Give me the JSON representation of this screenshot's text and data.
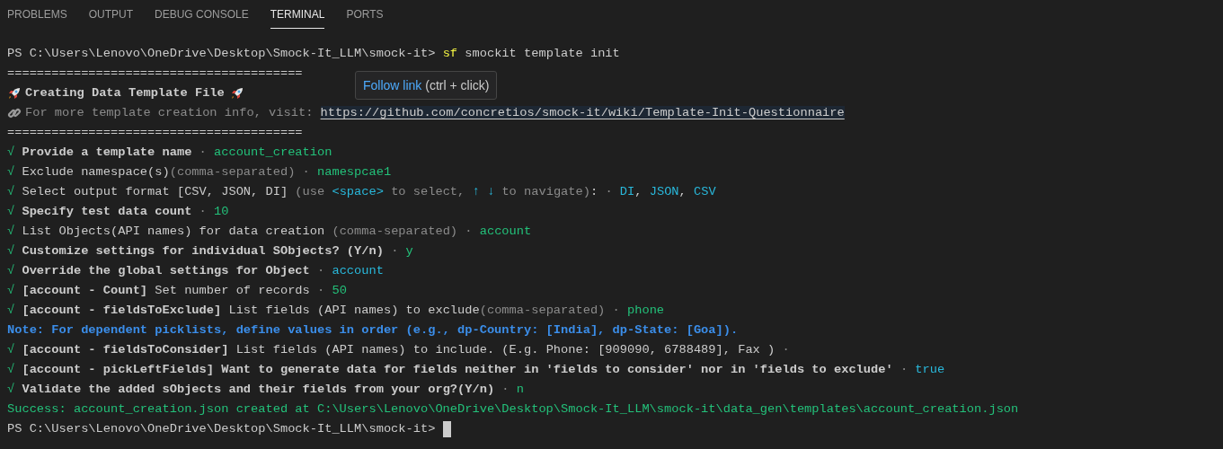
{
  "tabs": [
    {
      "label": "PROBLEMS",
      "selected": false
    },
    {
      "label": "OUTPUT",
      "selected": false
    },
    {
      "label": "DEBUG CONSOLE",
      "selected": false
    },
    {
      "label": "TERMINAL",
      "selected": true
    },
    {
      "label": "PORTS",
      "selected": false
    }
  ],
  "terminal": {
    "lines": [
      {
        "kind": "plain",
        "segments": [
          {
            "kind": "plain",
            "text": "PS C:\\Users\\Lenovo\\OneDrive\\Desktop\\Smock-It_LLM\\smock-it> "
          },
          {
            "kind": "yellow",
            "text": "sf"
          },
          {
            "kind": "plain",
            "text": " smockit template init"
          }
        ]
      },
      {
        "kind": "plain",
        "segments": [
          {
            "kind": "plain",
            "text": "========================================"
          }
        ]
      },
      {
        "kind": "banner",
        "segments": [
          {
            "kind": "bold",
            "text": "Creating Data Template File"
          }
        ]
      },
      {
        "kind": "info",
        "segments": [
          {
            "kind": "dim",
            "text": "For more template creation info, visit: "
          },
          {
            "kind": "link",
            "text": "https://github.com/concretios/smock-it/wiki/Template-Init-Questionnaire"
          }
        ]
      },
      {
        "kind": "plain",
        "segments": [
          {
            "kind": "plain",
            "text": "========================================"
          }
        ]
      },
      {
        "kind": "plain",
        "segments": [
          {
            "kind": "green",
            "text": "√ "
          },
          {
            "kind": "bold",
            "text": "Provide a template name"
          },
          {
            "kind": "dim",
            "text": " · "
          },
          {
            "kind": "green",
            "text": "account_creation"
          }
        ]
      },
      {
        "kind": "plain",
        "segments": [
          {
            "kind": "green",
            "text": "√ "
          },
          {
            "kind": "plain",
            "text": "Exclude namespace(s)"
          },
          {
            "kind": "dim",
            "text": "(comma-separated) · "
          },
          {
            "kind": "green",
            "text": "namespcae1"
          }
        ]
      },
      {
        "kind": "plain",
        "segments": [
          {
            "kind": "green",
            "text": "√ "
          },
          {
            "kind": "plain",
            "text": "Select output format [CSV, JSON, DI] "
          },
          {
            "kind": "dim",
            "text": "(use "
          },
          {
            "kind": "cyan",
            "text": "<space>"
          },
          {
            "kind": "dim",
            "text": " to select, "
          },
          {
            "kind": "cyan",
            "text": "↑ ↓"
          },
          {
            "kind": "dim",
            "text": " to navigate)"
          },
          {
            "kind": "plain",
            "text": ": "
          },
          {
            "kind": "dim",
            "text": "· "
          },
          {
            "kind": "cyan",
            "text": "DI"
          },
          {
            "kind": "plain",
            "text": ", "
          },
          {
            "kind": "cyan",
            "text": "JSON"
          },
          {
            "kind": "plain",
            "text": ", "
          },
          {
            "kind": "cyan",
            "text": "CSV"
          }
        ]
      },
      {
        "kind": "plain",
        "segments": [
          {
            "kind": "green",
            "text": "√ "
          },
          {
            "kind": "bold",
            "text": "Specify test data count"
          },
          {
            "kind": "dim",
            "text": " · "
          },
          {
            "kind": "green",
            "text": "10"
          }
        ]
      },
      {
        "kind": "plain",
        "segments": [
          {
            "kind": "green",
            "text": "√ "
          },
          {
            "kind": "plain",
            "text": "List Objects(API names) for data creation "
          },
          {
            "kind": "dim",
            "text": "(comma-separated) · "
          },
          {
            "kind": "green",
            "text": "account"
          }
        ]
      },
      {
        "kind": "plain",
        "segments": [
          {
            "kind": "green",
            "text": "√ "
          },
          {
            "kind": "bold",
            "text": "Customize settings for individual SObjects? (Y/n)"
          },
          {
            "kind": "dim",
            "text": " · "
          },
          {
            "kind": "green",
            "text": "y"
          }
        ]
      },
      {
        "kind": "plain",
        "segments": [
          {
            "kind": "green",
            "text": "√ "
          },
          {
            "kind": "bold",
            "text": "Override the global settings for Object"
          },
          {
            "kind": "dim",
            "text": " · "
          },
          {
            "kind": "cyan",
            "text": "account"
          }
        ]
      },
      {
        "kind": "plain",
        "segments": [
          {
            "kind": "green",
            "text": "√ "
          },
          {
            "kind": "bold",
            "text": "[account - Count]"
          },
          {
            "kind": "plain",
            "text": " Set number of records"
          },
          {
            "kind": "dim",
            "text": " · "
          },
          {
            "kind": "green",
            "text": "50"
          }
        ]
      },
      {
        "kind": "plain",
        "segments": [
          {
            "kind": "green",
            "text": "√ "
          },
          {
            "kind": "bold",
            "text": "[account - fieldsToExclude]"
          },
          {
            "kind": "plain",
            "text": " List fields (API names) to exclude"
          },
          {
            "kind": "dim",
            "text": "(comma-separated) · "
          },
          {
            "kind": "green",
            "text": "phone"
          }
        ]
      },
      {
        "kind": "plain",
        "segments": [
          {
            "kind": "note",
            "text": "Note: For dependent picklists, define values in order (e.g., dp-Country: [India], dp-State: [Goa])."
          }
        ]
      },
      {
        "kind": "plain",
        "segments": [
          {
            "kind": "green",
            "text": "√ "
          },
          {
            "kind": "bold",
            "text": "[account - fieldsToConsider]"
          },
          {
            "kind": "plain",
            "text": " List fields (API names) to include. (E.g. Phone: [909090, 6788489], Fax ) "
          },
          {
            "kind": "dim",
            "text": "·"
          }
        ]
      },
      {
        "kind": "plain",
        "segments": [
          {
            "kind": "green",
            "text": "√ "
          },
          {
            "kind": "bold",
            "text": "[account - pickLeftFields] Want to generate data for fields neither in 'fields to consider' nor in 'fields to exclude'"
          },
          {
            "kind": "dim",
            "text": " · "
          },
          {
            "kind": "cyan",
            "text": "true"
          }
        ]
      },
      {
        "kind": "plain",
        "segments": [
          {
            "kind": "green",
            "text": "√ "
          },
          {
            "kind": "bold",
            "text": "Validate the added sObjects and their fields from your org?(Y/n)"
          },
          {
            "kind": "dim",
            "text": " · "
          },
          {
            "kind": "green",
            "text": "n"
          }
        ]
      },
      {
        "kind": "plain",
        "segments": [
          {
            "kind": "green",
            "text": "Success: account_creation.json created at C:\\Users\\Lenovo\\OneDrive\\Desktop\\Smock-It_LLM\\smock-it\\data_gen\\templates\\account_creation.json"
          }
        ]
      },
      {
        "kind": "prompt",
        "segments": [
          {
            "kind": "plain",
            "text": "PS C:\\Users\\Lenovo\\OneDrive\\Desktop\\Smock-It_LLM\\smock-it> "
          }
        ]
      }
    ]
  },
  "tooltip": {
    "link": "Follow link",
    "hint": " (ctrl + click)"
  }
}
